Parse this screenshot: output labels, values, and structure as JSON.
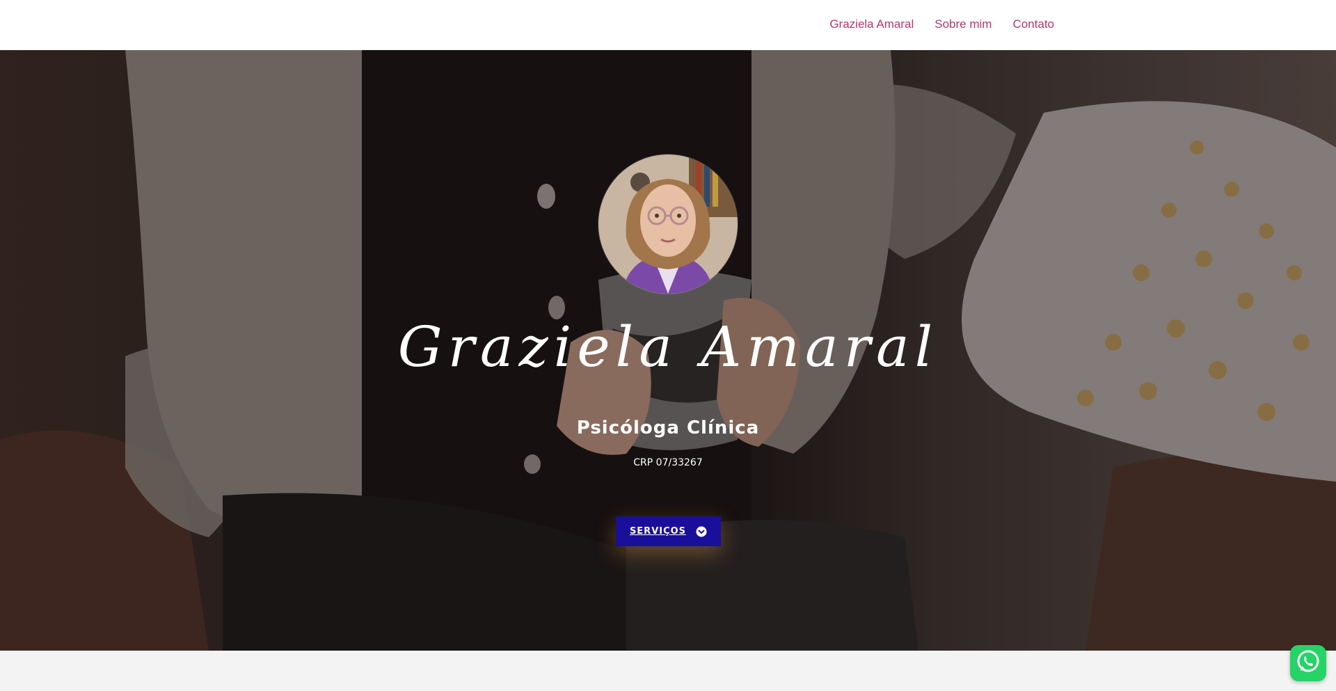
{
  "nav": {
    "items": [
      {
        "label": "Graziela Amaral"
      },
      {
        "label": "Sobre mim"
      },
      {
        "label": "Contato"
      }
    ]
  },
  "hero": {
    "name": "Graziela Amaral",
    "subtitle": "Psicóloga Clínica",
    "registration": "CRP 07/33267",
    "button_label": "SERVIÇOS",
    "button_icon": "chevron-circle-down-icon"
  },
  "floating": {
    "whatsapp_icon": "whatsapp-icon"
  },
  "colors": {
    "nav_link": "#b3366e",
    "button_bg": "#1a0f9a",
    "whatsapp": "#25d366"
  }
}
